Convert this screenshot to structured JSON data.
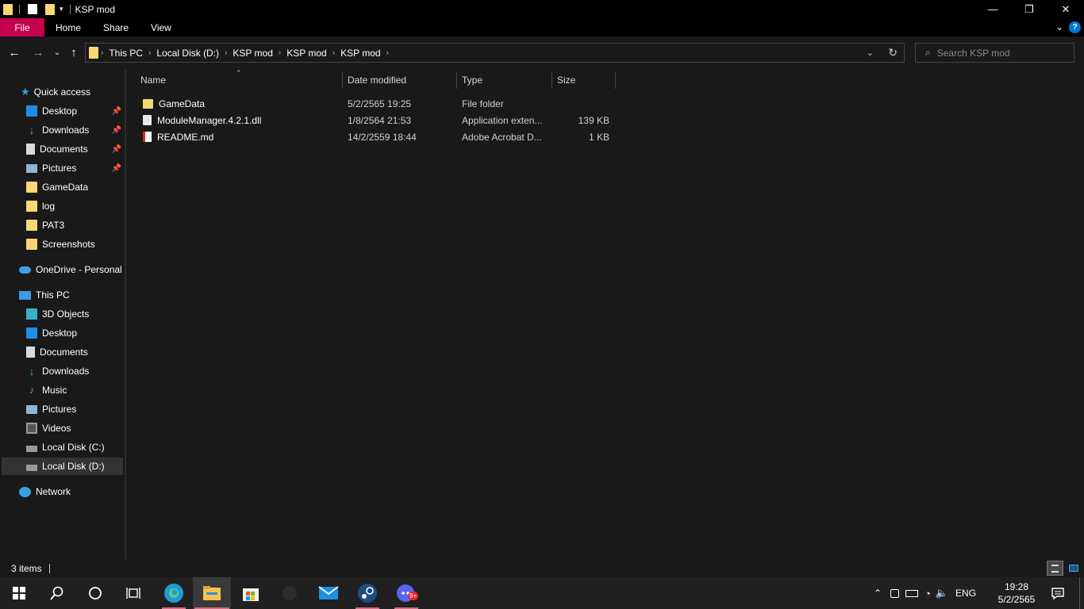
{
  "window": {
    "title": "KSP mod"
  },
  "ribbon": {
    "tabs": [
      "File",
      "Home",
      "Share",
      "View"
    ]
  },
  "address": {
    "crumbs": [
      "This PC",
      "Local Disk (D:)",
      "KSP mod",
      "KSP mod",
      "KSP mod"
    ],
    "search_placeholder": "Search KSP mod"
  },
  "sidebar": {
    "quick_access": "Quick access",
    "quick_items": [
      "Desktop",
      "Downloads",
      "Documents",
      "Pictures",
      "GameData",
      "log",
      "PAT3",
      "Screenshots"
    ],
    "onedrive": "OneDrive - Personal",
    "this_pc": "This PC",
    "pc_items": [
      "3D Objects",
      "Desktop",
      "Documents",
      "Downloads",
      "Music",
      "Pictures",
      "Videos",
      "Local Disk (C:)",
      "Local Disk (D:)"
    ],
    "network": "Network"
  },
  "columns": {
    "name": "Name",
    "date": "Date modified",
    "type": "Type",
    "size": "Size"
  },
  "files": [
    {
      "name": "GameData",
      "date": "5/2/2565 19:25",
      "type": "File folder",
      "size": ""
    },
    {
      "name": "ModuleManager.4.2.1.dll",
      "date": "1/8/2564 21:53",
      "type": "Application exten...",
      "size": "139 KB"
    },
    {
      "name": "README.md",
      "date": "14/2/2559 18:44",
      "type": "Adobe Acrobat D...",
      "size": "1 KB"
    }
  ],
  "status": {
    "items": "3 items"
  },
  "tray": {
    "lang": "ENG",
    "time": "19:28",
    "date": "5/2/2565",
    "badge": "9+"
  },
  "colors": {
    "file_tab": "#c4004f",
    "folder": "#f8d775",
    "accent": "#0078d7"
  }
}
